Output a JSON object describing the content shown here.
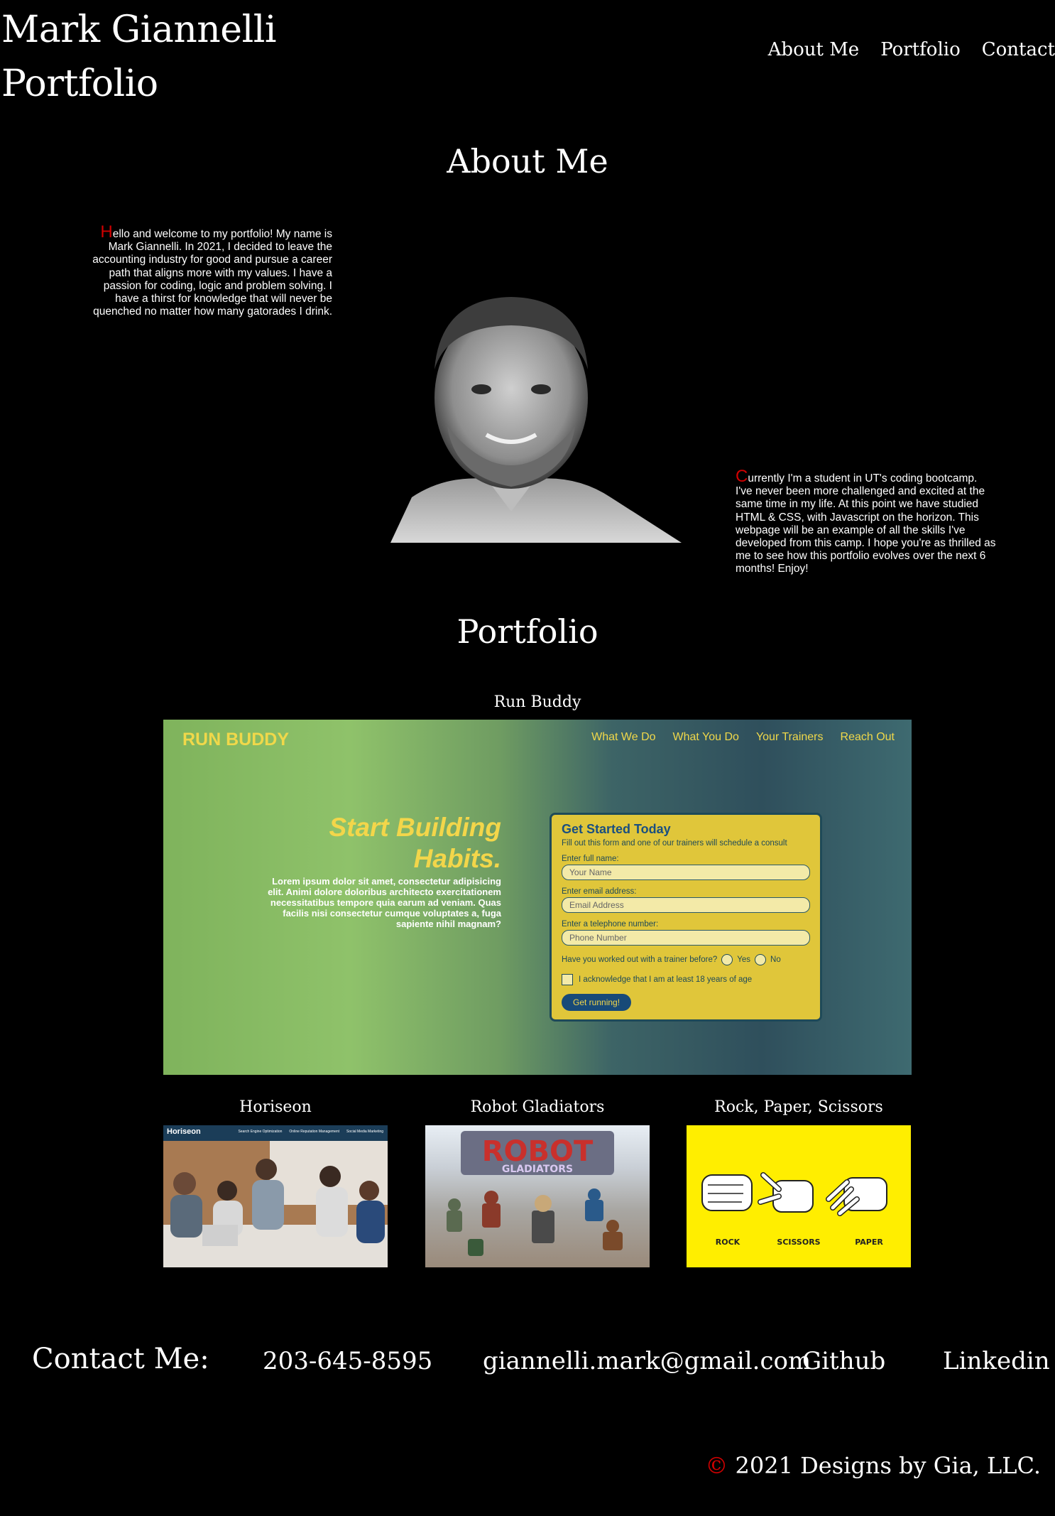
{
  "header": {
    "title_line1": "Mark Giannelli",
    "title_line2": "Portfolio",
    "nav": [
      "About Me",
      "Portfolio",
      "Contact"
    ]
  },
  "about": {
    "heading": "About Me",
    "bio1_cap": "H",
    "bio1_rest": "ello and welcome to my portfolio! My name is Mark Giannelli. In 2021, I decided to leave the accounting industry for good and pursue a career path that aligns more with my values. I have a passion for coding, logic and problem solving. I have a thirst for knowledge that will never be quenched no matter how many gatorades I drink.",
    "bio2_cap": "C",
    "bio2_rest": "urrently I'm a student in UT's coding bootcamp. I've never been more challenged and excited at the same time in my life. At this point we have studied HTML & CSS, with Javascript on the horizon. This webpage will be an example of all the skills I've developed from this camp. I hope you're as thrilled as me to see how this portfolio evolves over the next 6 months! Enjoy!"
  },
  "portfolio": {
    "heading": "Portfolio",
    "run_buddy": {
      "title": "Run Buddy",
      "logo": "RUN BUDDY",
      "nav": [
        "What We Do",
        "What You Do",
        "Your Trainers",
        "Reach Out"
      ],
      "hero_heading": "Start Building Habits.",
      "hero_text": "Lorem ipsum dolor sit amet, consectetur adipisicing elit. Animi dolore doloribus architecto exercitationem necessitatibus tempore quia earum ad veniam. Quas facilis nisi consectetur cumque voluptates a, fuga sapiente nihil magnam?",
      "form_title": "Get Started Today",
      "form_sub": "Fill out this form and one of our trainers will schedule a consult",
      "label_name": "Enter full name:",
      "ph_name": "Your Name",
      "label_email": "Enter email address:",
      "ph_email": "Email Address",
      "label_phone": "Enter a telephone number:",
      "ph_phone": "Phone Number",
      "question": "Have you worked out with a trainer before?",
      "yes": "Yes",
      "no": "No",
      "ack": "I acknowledge that I am at least 18 years of age",
      "button": "Get running!"
    },
    "horiseon": {
      "title": "Horiseon",
      "logo": "Horiseon",
      "nav": [
        "Search Engine Optimization",
        "Online Reputation Management",
        "Social Media Marketing"
      ]
    },
    "robot": {
      "title": "Robot Gladiators",
      "logo_top": "ROBOT",
      "logo_bottom": "GLADIATORS"
    },
    "rps": {
      "title": "Rock, Paper, Scissors",
      "labels": [
        "ROCK",
        "SCISSORS",
        "PAPER"
      ]
    }
  },
  "contact": {
    "label": "Contact Me:",
    "phone": "203-645-8595",
    "email": "giannelli.mark@gmail.com",
    "github": "Github",
    "linkedin": "Linkedin"
  },
  "footer": {
    "symbol": "©",
    "text": "2021 Designs by Gia, LLC."
  },
  "colors": {
    "background": "#000000",
    "accent_red": "#d10000",
    "text": "#ffffff"
  }
}
